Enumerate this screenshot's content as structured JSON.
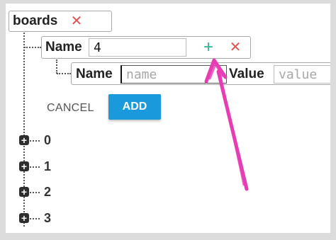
{
  "root": {
    "label": "boards",
    "remove_icon": "close-icon"
  },
  "new_key_row": {
    "name_label": "Name",
    "name_value": "4",
    "add_icon": "plus-icon",
    "remove_icon": "close-icon"
  },
  "child_row": {
    "name_label": "Name",
    "name_placeholder": "name",
    "value_label": "Value",
    "value_placeholder": "value"
  },
  "actions": {
    "cancel_label": "CANCEL",
    "add_label": "ADD"
  },
  "nodes": [
    {
      "label": "0",
      "icon": "plus-square-icon"
    },
    {
      "label": "1",
      "icon": "plus-square-icon"
    },
    {
      "label": "2",
      "icon": "plus-square-icon"
    },
    {
      "label": "3",
      "icon": "plus-square-icon"
    }
  ],
  "annotation": {
    "icon": "hand-drawn-arrow-icon",
    "color": "#e83cb5"
  },
  "colors": {
    "add_button": "#1a99dc",
    "remove_icon": "#e05252",
    "add_icon": "#2bb594"
  }
}
